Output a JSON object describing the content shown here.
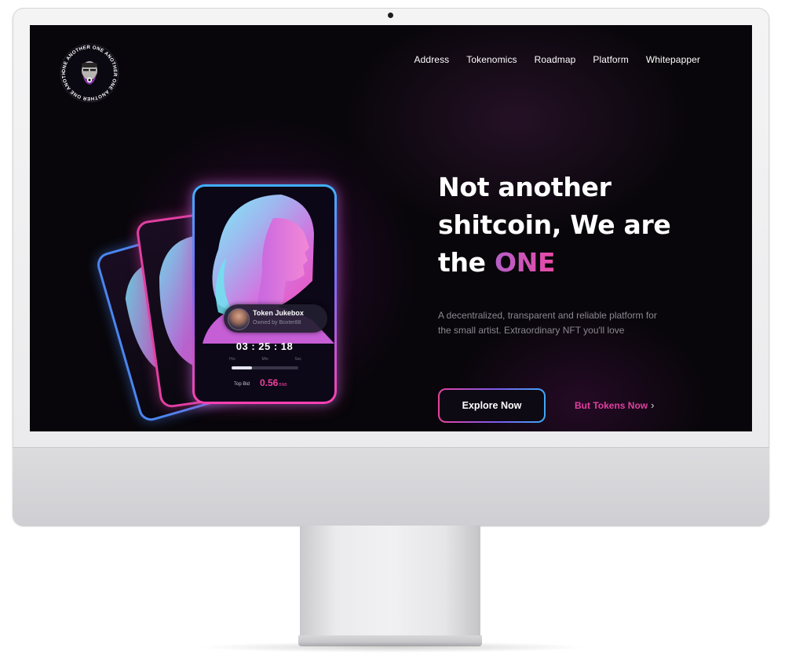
{
  "logo": {
    "ring_text": "ONE ANOTHER ONE ANOTHER ONE ANOTHER ONE ANOTHER "
  },
  "nav": {
    "items": [
      "Address",
      "Tokenomics",
      "Roadmap",
      "Platform",
      "Whitepapper"
    ]
  },
  "hero": {
    "headline_line1": "Not another",
    "headline_line2": "shitcoin, We are",
    "headline_prefix": "the ",
    "headline_accent": "ONE",
    "subtitle": "A decentralized, transparent and reliable platform for the small artist. Extraordinary NFT you'll love",
    "primary_button": "Explore Now",
    "secondary_link": "But Tokens Now",
    "secondary_link_icon": "chevron-right-icon"
  },
  "nft_card": {
    "title": "Token Jukebox",
    "owner": "Owned by Boxter88",
    "timer": "03 : 25 : 18",
    "timer_units": [
      "Hrs",
      "Min",
      "Sec"
    ],
    "progress": 0.3,
    "bid_label": "Top Bid",
    "bid_value": "0.56",
    "bid_unit": "BNB"
  },
  "colors": {
    "accent_pink": "#e0409e",
    "accent_purple": "#b65ec8",
    "accent_blue": "#3fa9f5",
    "background": "#08060a"
  }
}
